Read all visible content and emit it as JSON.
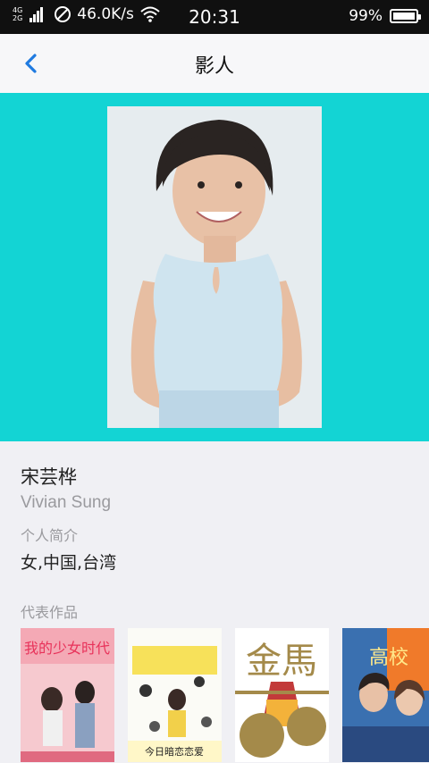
{
  "status_bar": {
    "network_top": "4G",
    "network_bottom": "2G",
    "speed": "46.0K/s",
    "time": "20:31",
    "battery": "99%"
  },
  "nav": {
    "title": "影人"
  },
  "person": {
    "name": "宋芸桦",
    "english_name": "Vivian Sung",
    "intro_label": "个人简介",
    "intro": "女,中国,台湾"
  },
  "works": {
    "label": "代表作品",
    "posters": [
      {
        "title_text": "我的少女时代"
      },
      {
        "title_text": "今日暗恋恋爱"
      },
      {
        "title_text": "金馬"
      },
      {
        "title_text": "高校"
      }
    ]
  },
  "colors": {
    "banner": "#13d4d4",
    "accent": "#1f7ae0"
  }
}
